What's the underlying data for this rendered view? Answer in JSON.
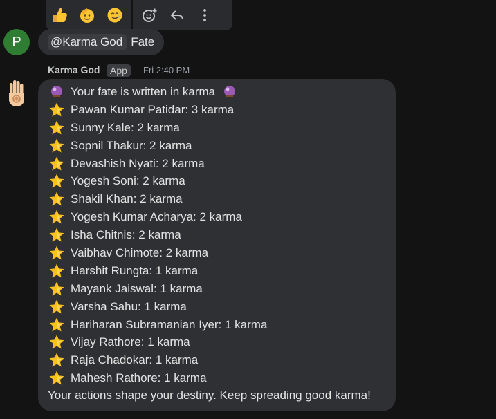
{
  "toolbar": {
    "reactions": [
      {
        "name": "thumbs-up-emoji"
      },
      {
        "name": "saluting-face-emoji"
      },
      {
        "name": "smiling-face-with-tear-emoji"
      }
    ],
    "actions": [
      {
        "name": "add-reaction-icon"
      },
      {
        "name": "reply-icon"
      },
      {
        "name": "more-options-icon"
      }
    ]
  },
  "user_message": {
    "avatar_letter": "P",
    "mention_at": "@",
    "mention_name": "Karma God",
    "text": "Fate"
  },
  "bot_message": {
    "sender": "Karma God",
    "badge": "App",
    "time": "Fri 2:40 PM",
    "header": "Your fate is written in karma",
    "entries": [
      "Pawan Kumar Patidar: 3 karma",
      "Sunny Kale: 2 karma",
      "Sopnil Thakur: 2 karma",
      "Devashish Nyati: 2 karma",
      "Yogesh Soni: 2 karma",
      "Shakil Khan: 2 karma",
      "Yogesh Kumar Acharya: 2 karma",
      "Isha Chitnis: 2 karma",
      "Vaibhav Chimote: 2 karma",
      "Harshit Rungta: 1 karma",
      "Mayank Jaiswal: 1 karma",
      "Varsha Sahu: 1 karma",
      "Hariharan Subramanian Iyer: 1 karma",
      "Vijay Rathore: 1 karma",
      "Raja Chadokar: 1 karma",
      "Mahesh Rathore: 1 karma"
    ],
    "footer": "Your actions shape your destiny. Keep spreading good karma!"
  },
  "colors": {
    "background": "#131314",
    "bubble": "#2f3033",
    "avatar": "#2e7d32",
    "star": "#f9c21b",
    "crystal_ball": "#8e44ad"
  }
}
